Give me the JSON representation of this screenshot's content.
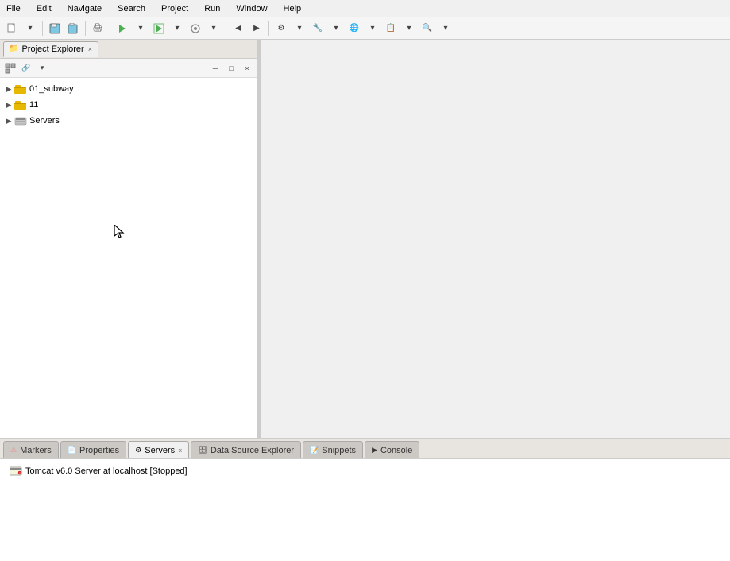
{
  "menubar": {
    "items": [
      "File",
      "Edit",
      "Navigate",
      "Search",
      "Project",
      "Run",
      "Window",
      "Help"
    ]
  },
  "leftPanel": {
    "tab": {
      "label": "Project Explorer",
      "close": "×"
    },
    "toolbar": {
      "buttons": [
        "collapse",
        "link",
        "view_menu",
        "minimize",
        "maximize",
        "close"
      ]
    },
    "tree": {
      "items": [
        {
          "id": "01_subway",
          "label": "01_subway",
          "level": 1,
          "type": "project",
          "expanded": false
        },
        {
          "id": "11",
          "label": "11",
          "level": 1,
          "type": "project",
          "expanded": false
        },
        {
          "id": "Servers",
          "label": "Servers",
          "level": 1,
          "type": "servers",
          "expanded": false
        }
      ]
    }
  },
  "bottomPanel": {
    "tabs": [
      {
        "id": "markers",
        "label": "Markers",
        "active": false,
        "closeable": false
      },
      {
        "id": "properties",
        "label": "Properties",
        "active": false,
        "closeable": false
      },
      {
        "id": "servers",
        "label": "Servers",
        "active": true,
        "closeable": true
      },
      {
        "id": "datasource",
        "label": "Data Source Explorer",
        "active": false,
        "closeable": false
      },
      {
        "id": "snippets",
        "label": "Snippets",
        "active": false,
        "closeable": false
      },
      {
        "id": "console",
        "label": "Console",
        "active": false,
        "closeable": false
      }
    ],
    "servers": {
      "item": "Tomcat v6.0 Server at localhost  [Stopped]"
    }
  }
}
